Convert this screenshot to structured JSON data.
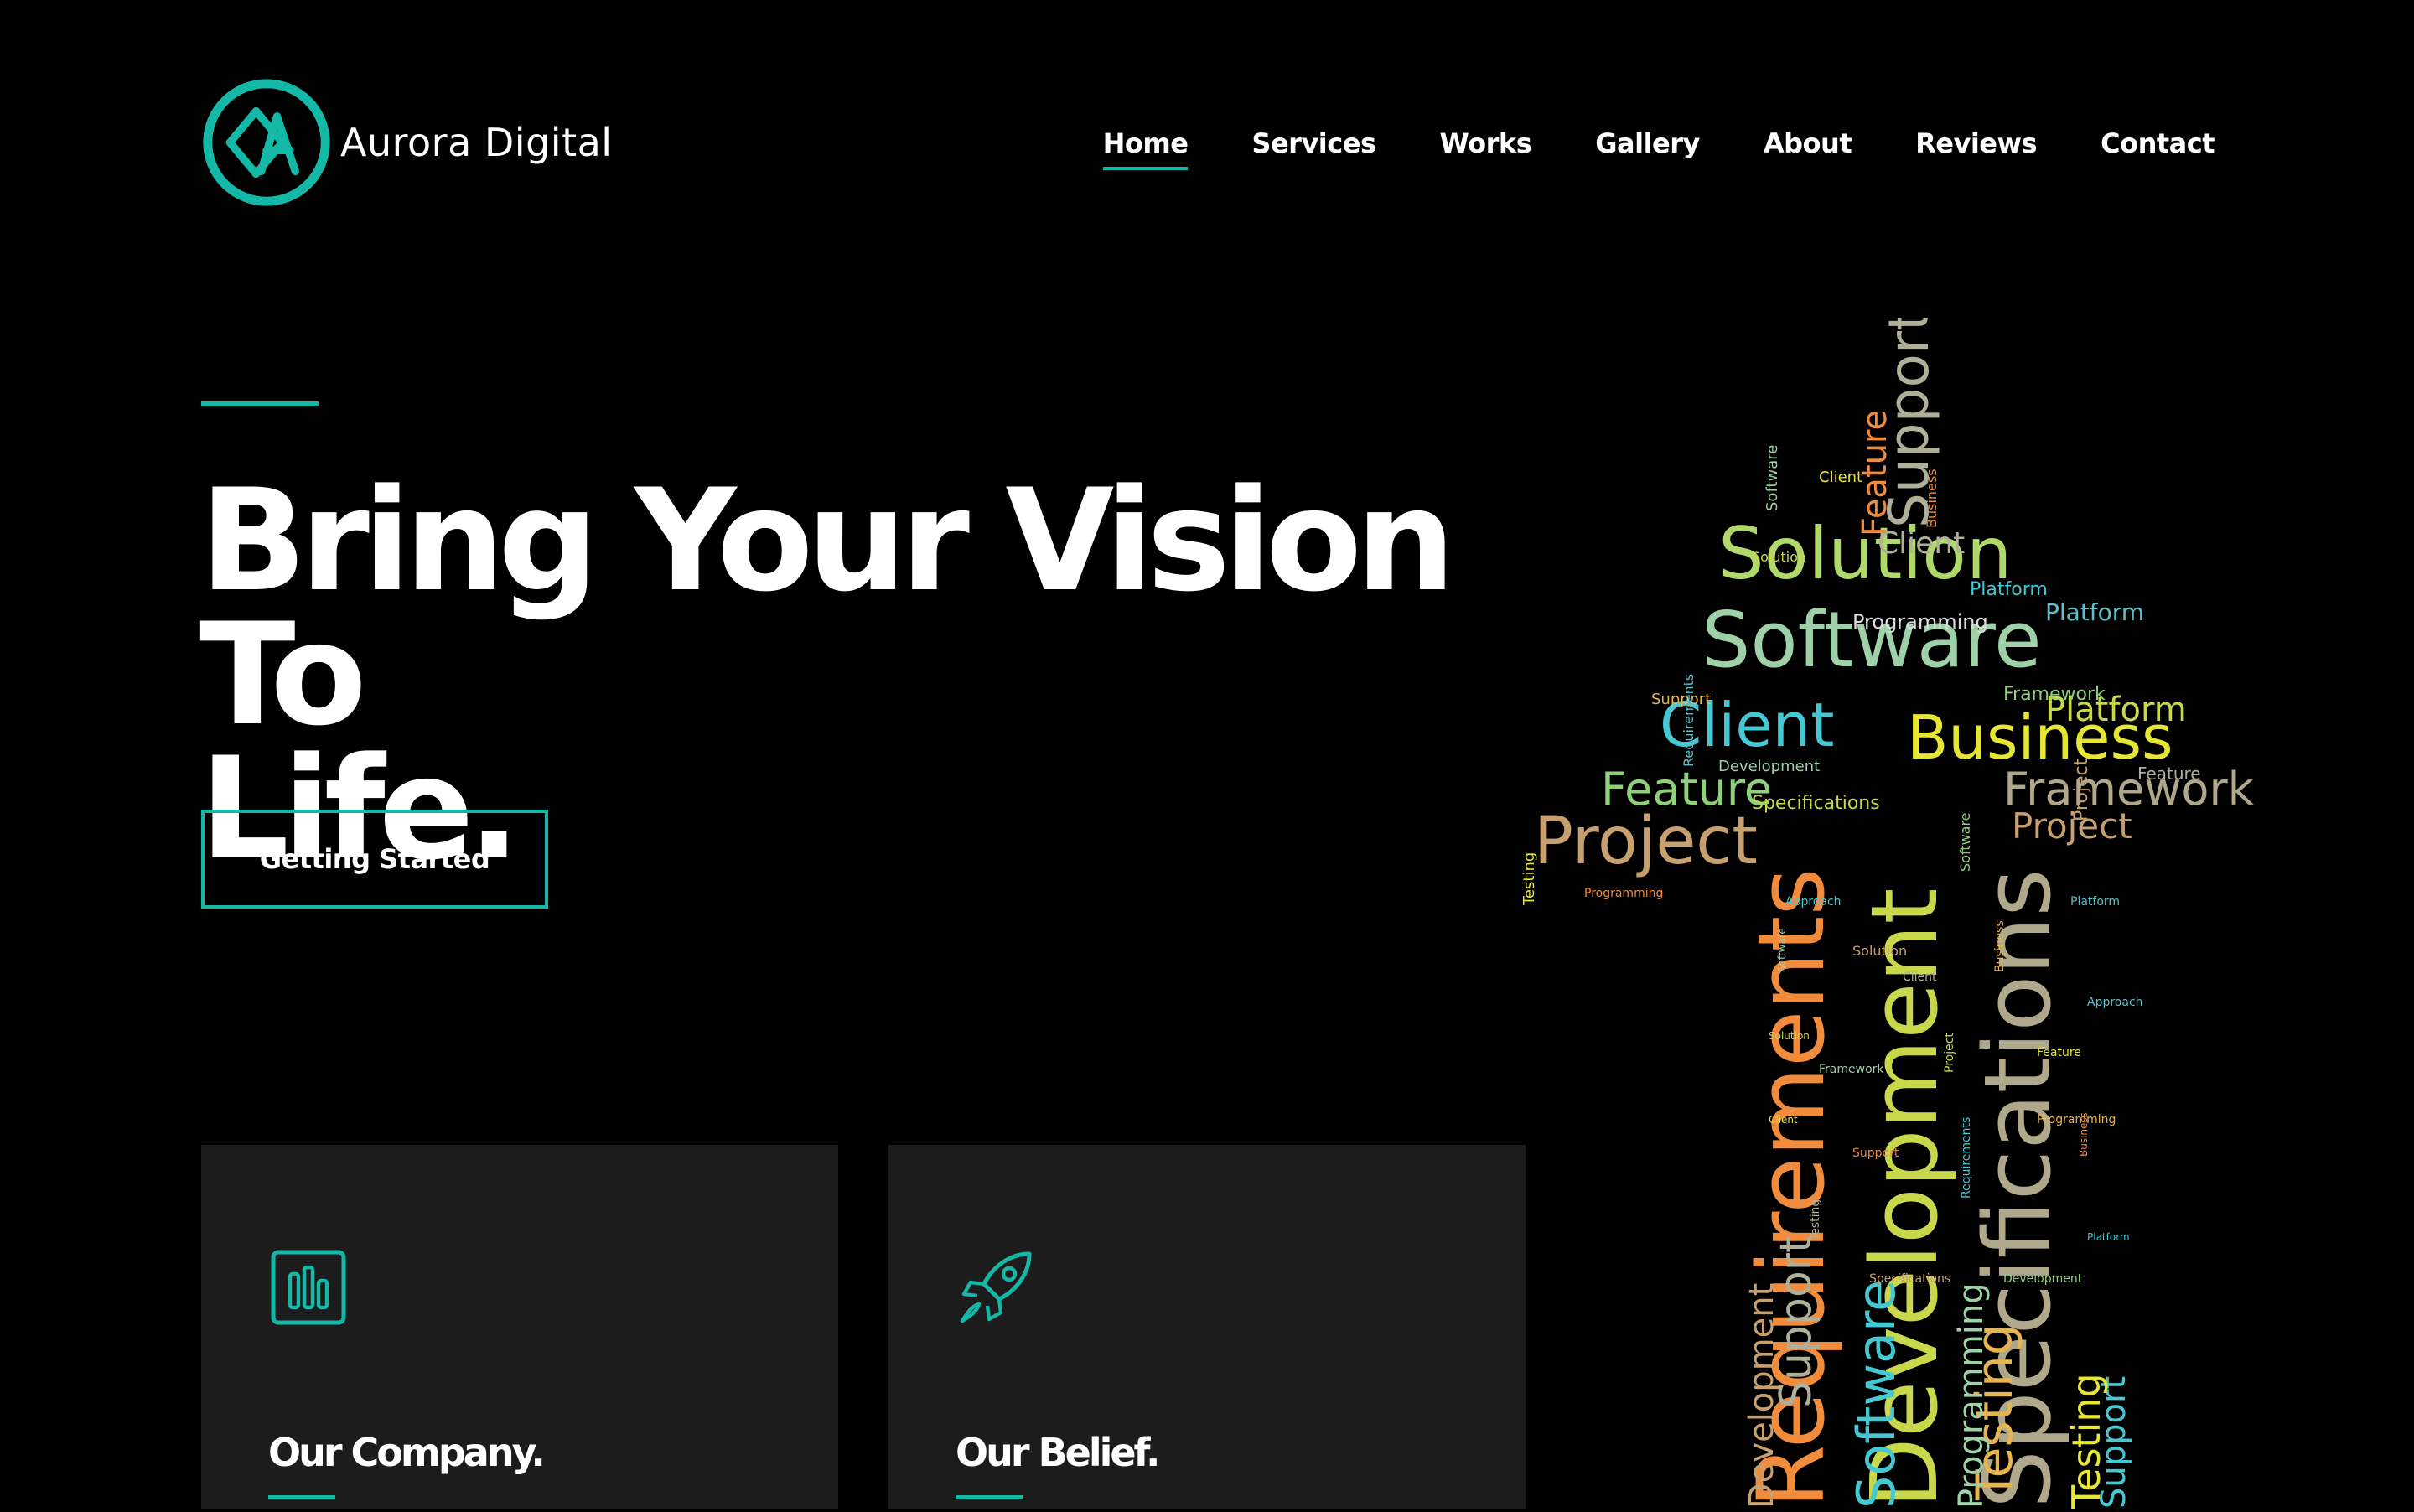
{
  "brand": {
    "name": "Aurora Digital",
    "logo_icon": "aurora-a-logo-icon"
  },
  "nav": {
    "items": [
      {
        "label": "Home",
        "active": true
      },
      {
        "label": "Services",
        "active": false
      },
      {
        "label": "Works",
        "active": false
      },
      {
        "label": "Gallery",
        "active": false
      },
      {
        "label": "About",
        "active": false
      },
      {
        "label": "Reviews",
        "active": false
      },
      {
        "label": "Contact",
        "active": false
      }
    ]
  },
  "hero": {
    "title_line1": "Bring Your Vision To",
    "title_line2": "Life.",
    "cta_label": "Getting Started"
  },
  "cards": [
    {
      "title": "Our Company.",
      "icon": "bar-chart-icon"
    },
    {
      "title": "Our Belief.",
      "icon": "rocket-icon"
    }
  ],
  "word_cloud": {
    "shape": "up-arrow",
    "words": [
      "Software",
      "Solution",
      "Client",
      "Business",
      "Platform",
      "Framework",
      "Project",
      "Feature",
      "Support",
      "Requirements",
      "Development",
      "Specifications",
      "Testing",
      "Programming",
      "Approach"
    ]
  },
  "colors": {
    "accent": "#14b8a6",
    "background": "#000000",
    "card": "#1c1c1c",
    "text": "#ffffff"
  }
}
